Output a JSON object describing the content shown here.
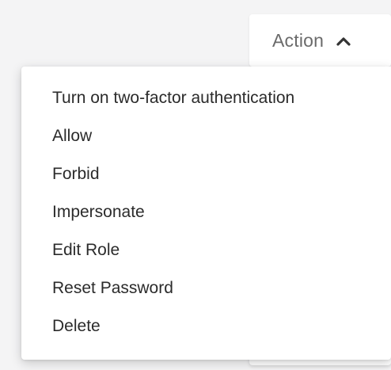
{
  "action_button": {
    "label": "Action",
    "icon": "chevron-up-icon"
  },
  "menu": {
    "items": [
      {
        "label": "Turn on two-factor authentication"
      },
      {
        "label": "Allow"
      },
      {
        "label": "Forbid"
      },
      {
        "label": "Impersonate"
      },
      {
        "label": "Edit Role"
      },
      {
        "label": "Reset Password"
      },
      {
        "label": "Delete"
      }
    ]
  },
  "colors": {
    "background": "#f4f4f5",
    "surface": "#ffffff",
    "text": "#2b2b2b",
    "muted_text": "#6a6a6a"
  }
}
